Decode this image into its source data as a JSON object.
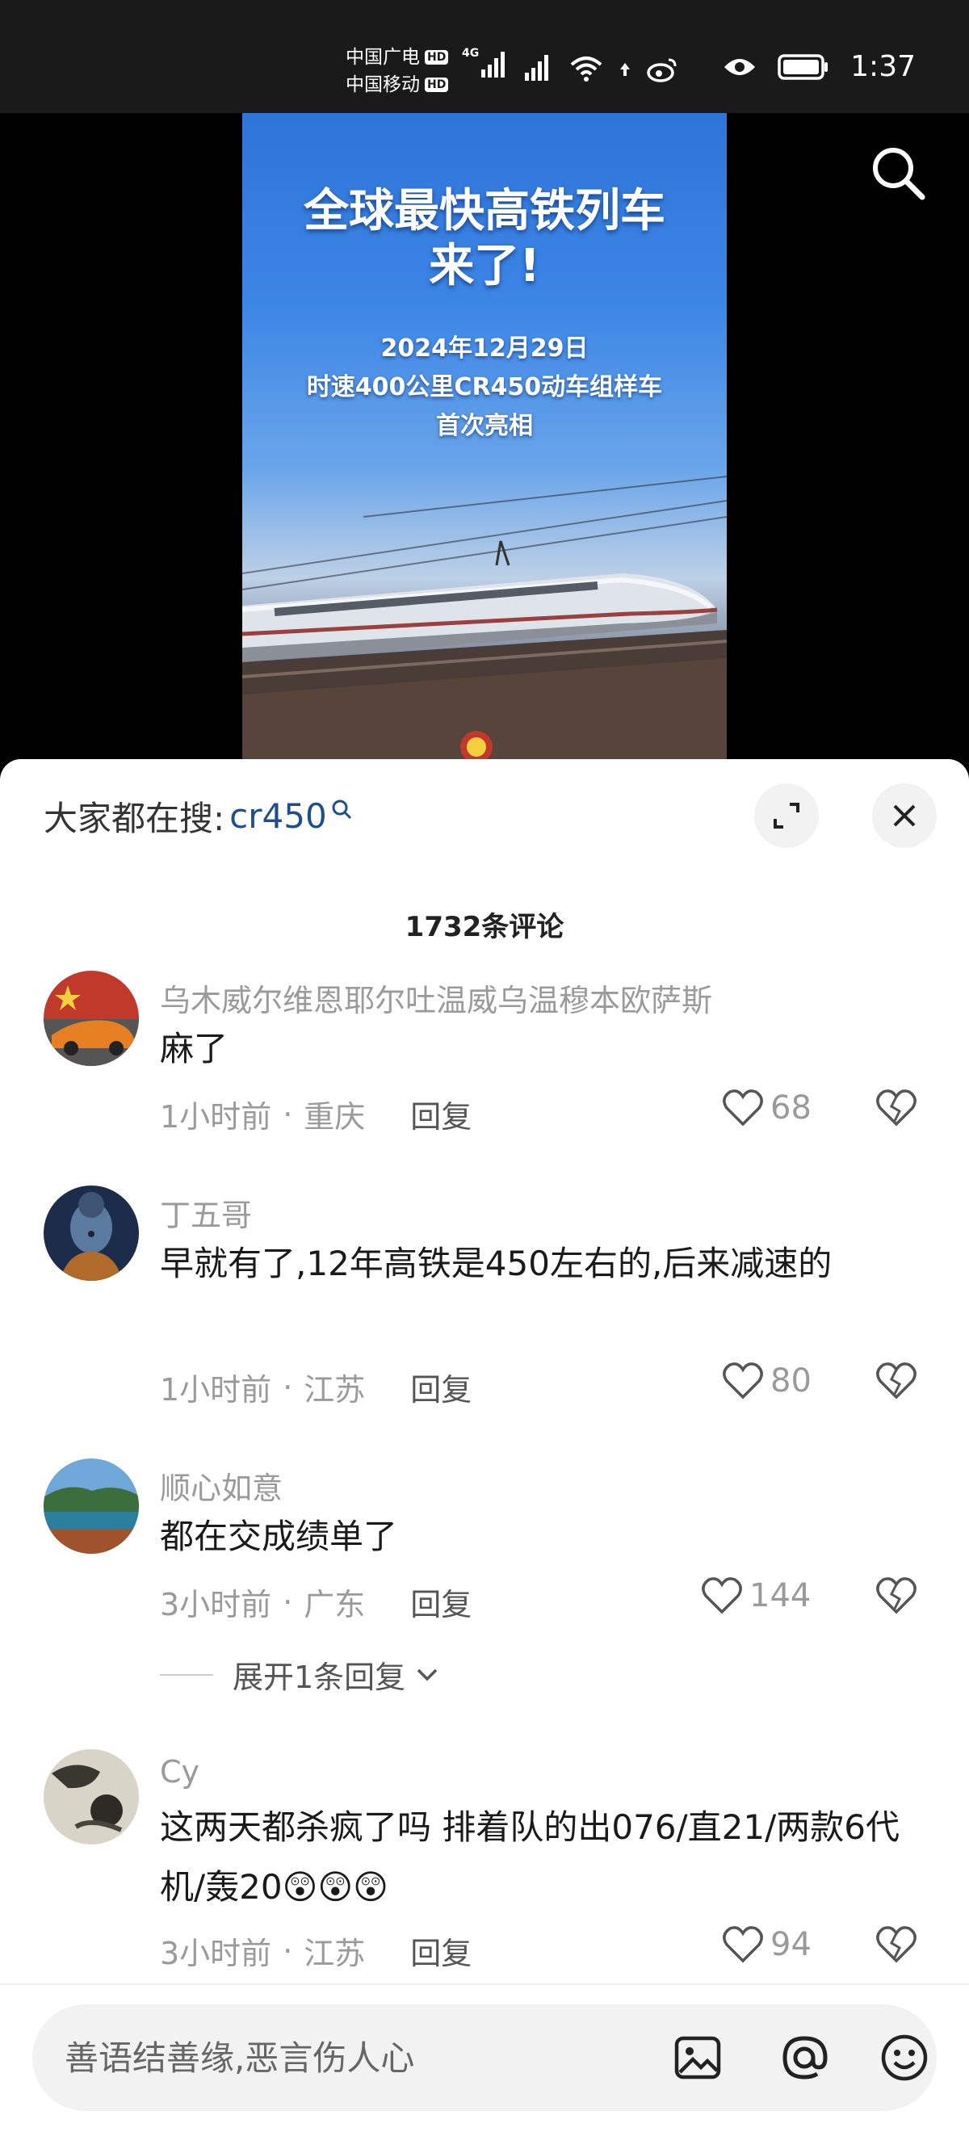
{
  "status_bar": {
    "carrier1": "中国广电",
    "carrier2": "中国移动",
    "hd_badge": "HD",
    "network": "4G",
    "time": "1:37"
  },
  "poster": {
    "title_line1": "全球最快高铁列车",
    "title_line2": "来了!",
    "subtitle_line1": "2024年12月29日",
    "subtitle_line2": "时速400公里CR450动车组样车",
    "subtitle_line3": "首次亮相"
  },
  "comments_panel": {
    "hot_search_label": "大家都在搜:",
    "hot_search_term": "cr450",
    "count_text": "1732条评论",
    "input_placeholder": "善语结善缘,恶言伤人心",
    "comments": [
      {
        "name": "乌木威尔维恩耶尔吐温威乌温穆本欧萨斯",
        "text": "麻了",
        "time": "1小时前",
        "location": "重庆",
        "reply": "回复",
        "likes": "68"
      },
      {
        "name": "丁五哥",
        "text": "早就有了,12年高铁是450左右的,后来减速的",
        "time": "1小时前",
        "location": "江苏",
        "reply": "回复",
        "likes": "80"
      },
      {
        "name": "顺心如意",
        "text": "都在交成绩单了",
        "time": "3小时前",
        "location": "广东",
        "reply": "回复",
        "likes": "144",
        "expand": "展开1条回复"
      },
      {
        "name": "Cy",
        "text": "这两天都杀疯了吗  排着队的出076/直21/两款6代机/轰20😲😲😲",
        "time": "3小时前",
        "location": "江苏",
        "reply": "回复",
        "likes": "94"
      }
    ]
  }
}
